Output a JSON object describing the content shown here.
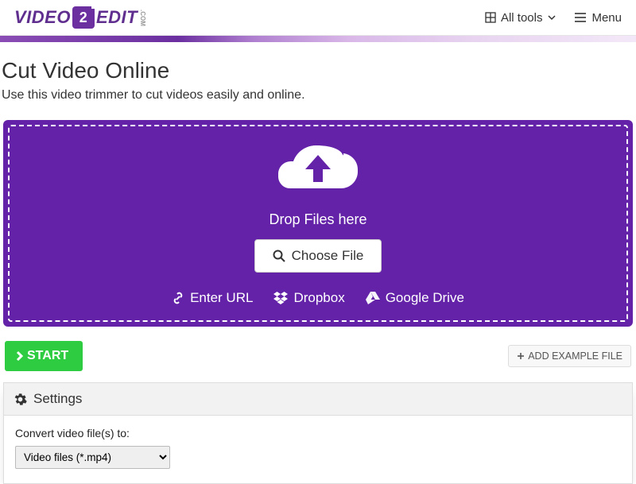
{
  "logo": {
    "part1": "VIDEO",
    "mid": "2",
    "part2": "EDIT",
    "suffix": ".COM"
  },
  "header": {
    "alltools": "All tools",
    "menu": "Menu"
  },
  "page": {
    "title": "Cut Video Online",
    "subtitle": "Use this video trimmer to cut videos easily and online."
  },
  "dropzone": {
    "drop_text": "Drop Files here",
    "choose_file": "Choose File",
    "enter_url": "Enter URL",
    "dropbox": "Dropbox",
    "gdrive": "Google Drive"
  },
  "actions": {
    "start": "START",
    "add_example": "ADD EXAMPLE FILE"
  },
  "settings": {
    "heading": "Settings",
    "convert_label": "Convert video file(s) to:",
    "convert_selected": "Video files (*.mp4)"
  }
}
